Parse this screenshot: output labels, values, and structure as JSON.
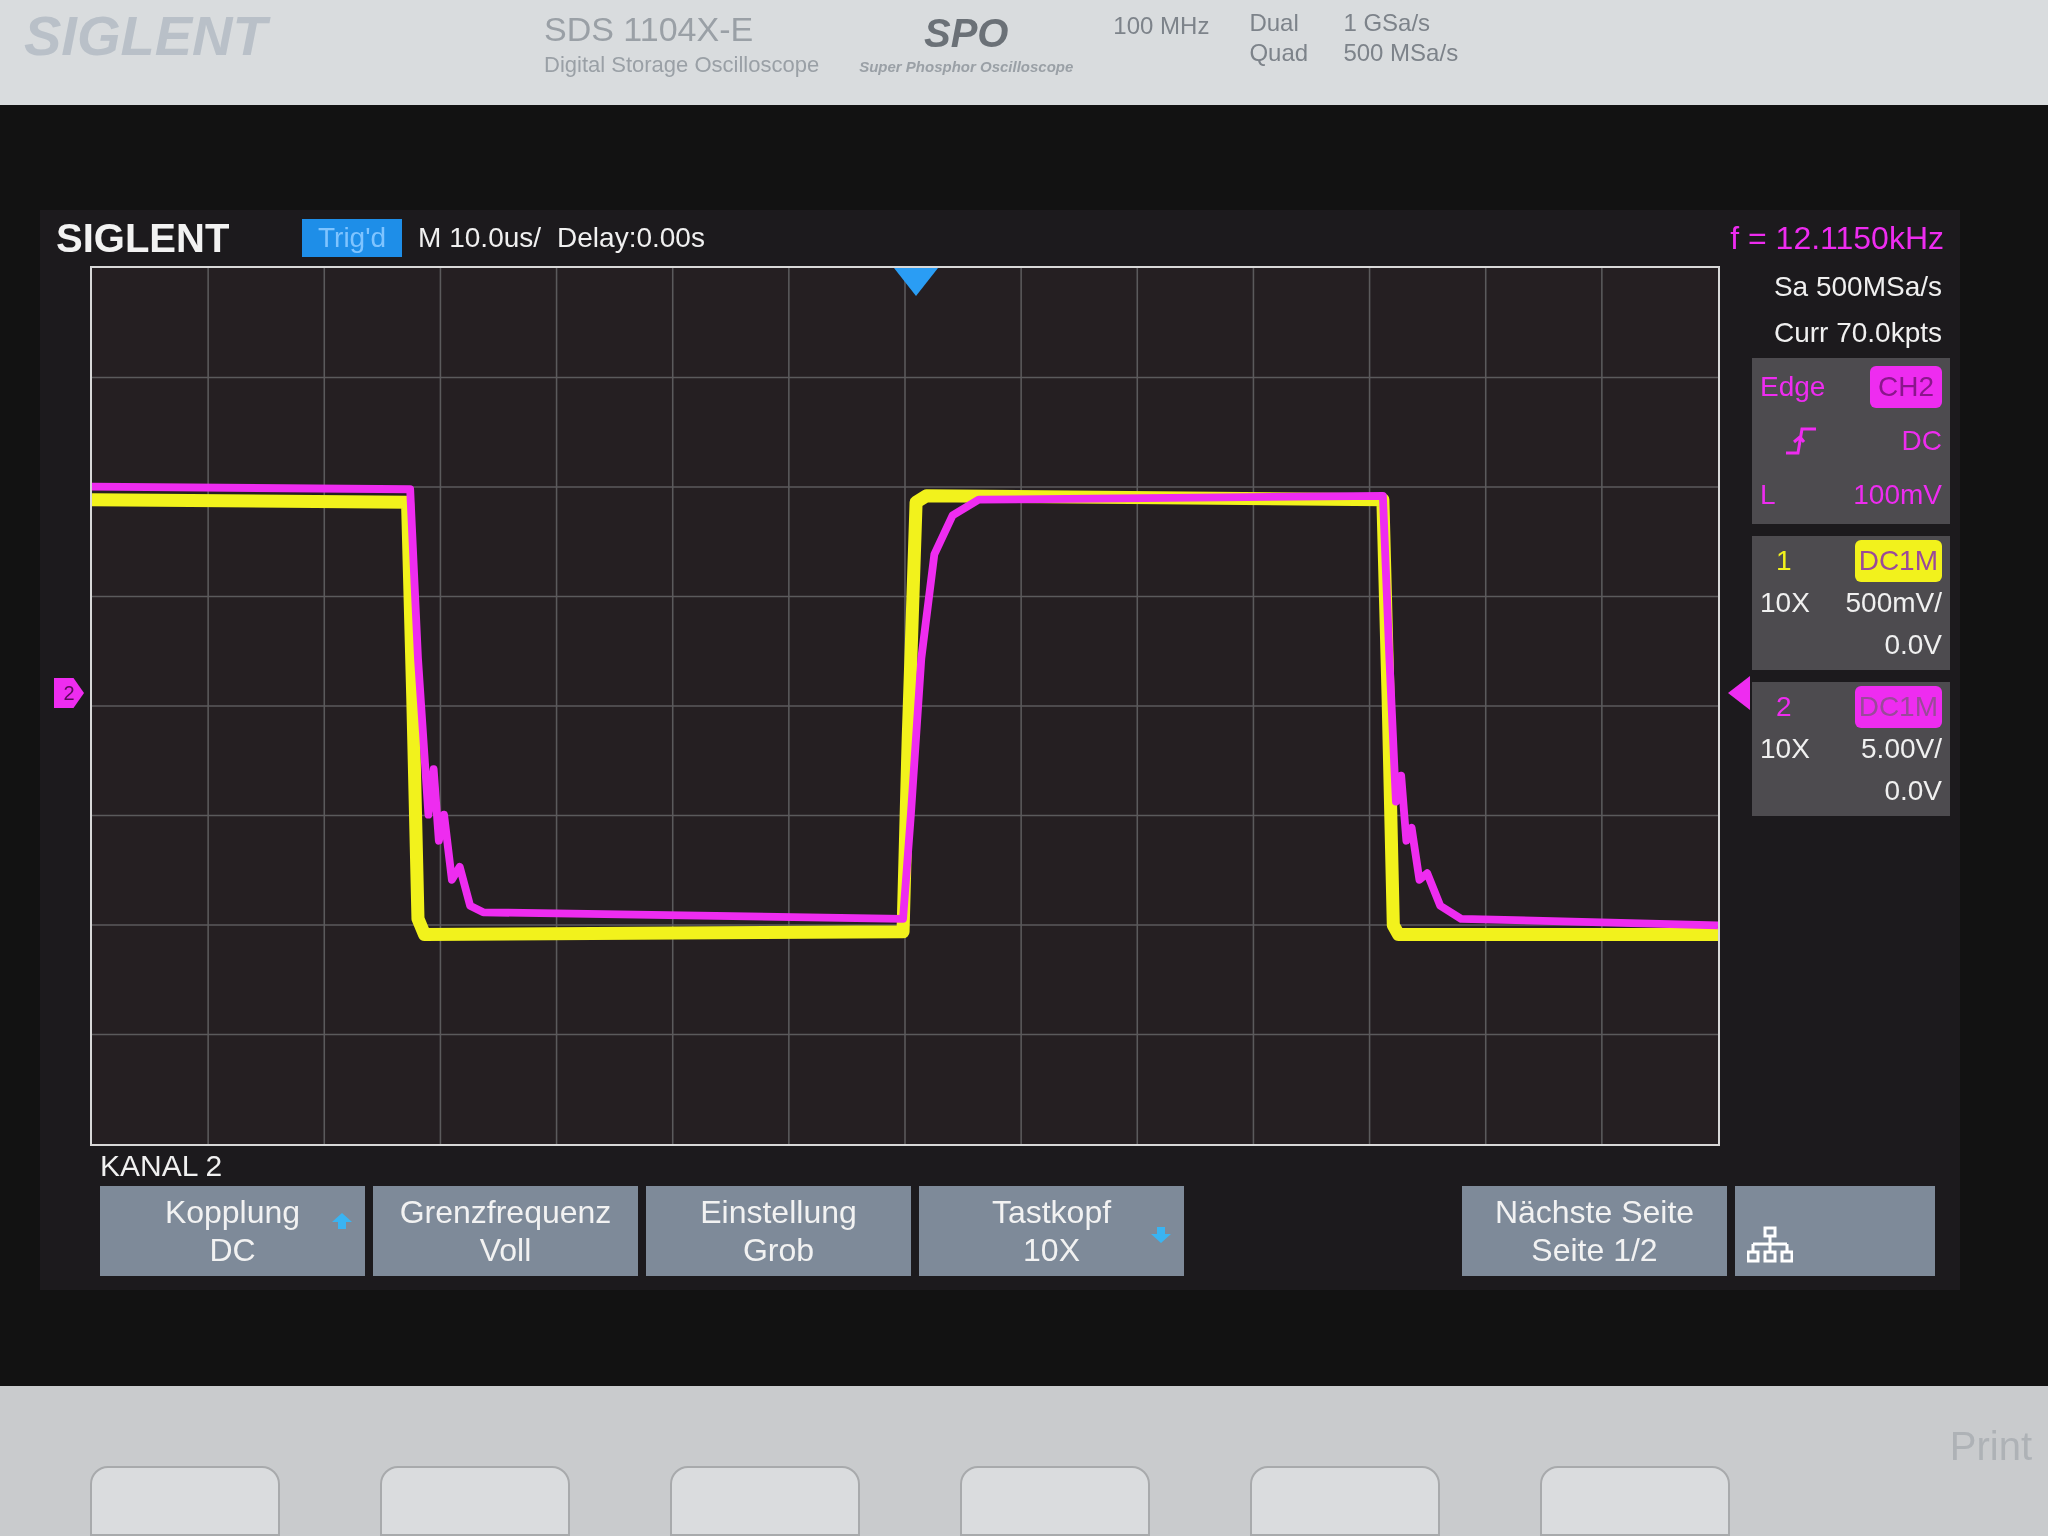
{
  "device_label": {
    "brand": "SIGLENT",
    "model": "SDS 1104X-E",
    "description": "Digital Storage Oscilloscope",
    "series_logo": "SPO",
    "series_name": "Super Phosphor Oscilloscope",
    "bandwidth": "100 MHz",
    "rates": [
      {
        "mode": "Dual",
        "rate": "1 GSa/s"
      },
      {
        "mode": "Quad",
        "rate": "500 MSa/s"
      }
    ]
  },
  "status_bar": {
    "logo": "SIGLENT",
    "trigger_status": "Trig'd",
    "timebase": "M 10.0us/",
    "delay": "Delay:0.00s",
    "frequency": "f = 12.1150kHz"
  },
  "acquisition": {
    "sample_rate": "Sa 500MSa/s",
    "memory": "Curr 70.0kpts"
  },
  "trigger": {
    "type": "Edge",
    "source": "CH2",
    "coupling": "DC",
    "level_label": "L",
    "level": "100mV"
  },
  "channels": [
    {
      "number": "1",
      "color": "#f2f21c",
      "coupling": "DC1M",
      "probe": "10X",
      "scale": "500mV/",
      "offset": "0.0V"
    },
    {
      "number": "2",
      "color": "#ee2cf0",
      "coupling": "DC1M",
      "probe": "10X",
      "scale": "5.00V/",
      "offset": "0.0V",
      "marker": "2"
    }
  ],
  "menu": {
    "title": "KANAL 2",
    "buttons": [
      {
        "label": "Kopplung",
        "value": "DC",
        "kind": "up"
      },
      {
        "label": "Grenzfrequenz",
        "value": "Voll",
        "kind": "plain"
      },
      {
        "label": "Einstellung",
        "value": "Grob",
        "kind": "plain"
      },
      {
        "label": "Tastkopf",
        "value": "10X",
        "kind": "down"
      },
      {
        "label": "Nächste Seite",
        "value": "Seite 1/2",
        "kind": "plain"
      }
    ]
  },
  "front_panel": {
    "print_label": "Print"
  }
}
